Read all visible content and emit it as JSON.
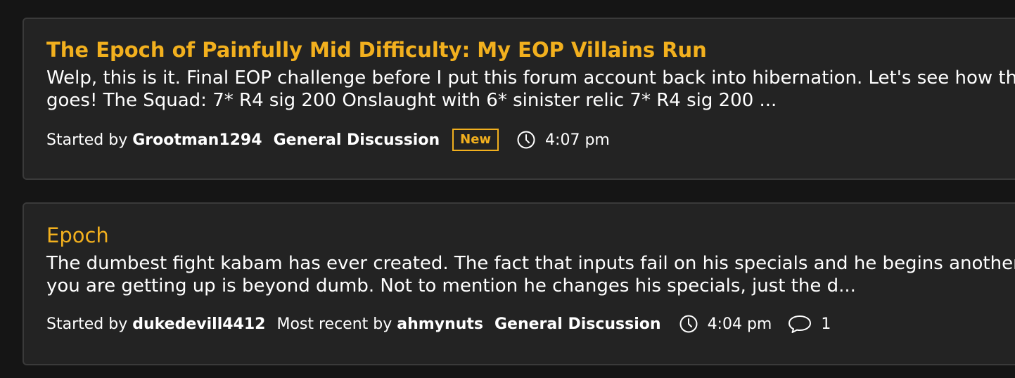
{
  "posts": [
    {
      "title": "The Epoch of Painfully Mid Difficulty: My EOP Villains Run",
      "excerpt_line1": "Welp, this is it. Final EOP challenge before I put this forum account back into hibernation. Let's see how thi",
      "excerpt_line2": "goes! The Squad: 7* R4 sig 200 Onslaught with 6* sinister relic 7* R4 sig 200 ...",
      "started_by_label": "Started by",
      "author": "Grootman1294",
      "category": "General Discussion",
      "badge": "New",
      "time": "4:07 pm",
      "icons": {
        "clock": "clock-icon"
      }
    },
    {
      "title": "Epoch",
      "excerpt_line1": "The dumbest fight kabam has ever created. The fact that inputs fail on his specials and he begins another",
      "excerpt_line2": "you are getting up is beyond dumb. Not to mention he changes his specials, just the d...",
      "started_by_label": "Started by",
      "author": "dukedevill4412",
      "most_recent_label": "Most recent by",
      "most_recent_author": "ahmynuts",
      "category": "General Discussion",
      "time": "4:04 pm",
      "comments": "1",
      "icons": {
        "clock": "clock-icon",
        "comments": "comment-bubble-icon"
      }
    }
  ],
  "colors": {
    "background": "#151515",
    "card": "#232323",
    "card_border": "#3a3a3a",
    "accent": "#f2b01e",
    "text": "#ffffff"
  }
}
